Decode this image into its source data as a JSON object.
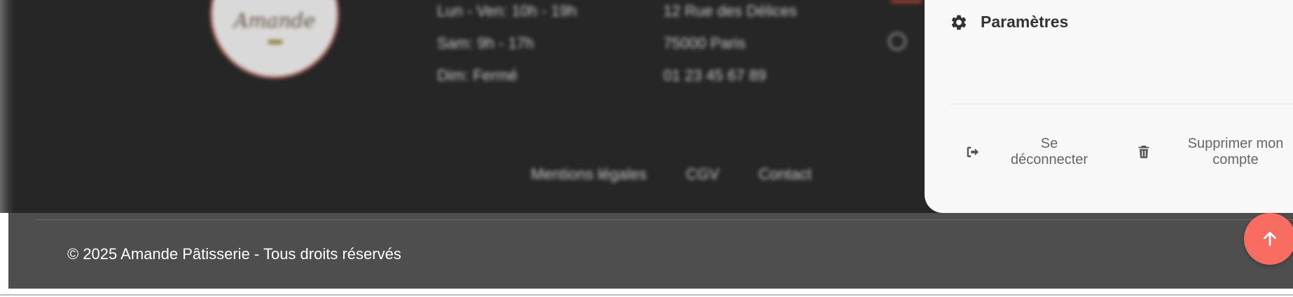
{
  "background_footer": {
    "hours": [
      "Lun - Ven: 10h - 19h",
      "Sam: 9h - 17h",
      "Dim: Fermé"
    ],
    "address": [
      "12 Rue des Délices",
      "75000 Paris",
      "01 23 45 67 89"
    ],
    "links": [
      "Mentions légales",
      "CGV",
      "Contact"
    ],
    "logo_text": "Amande"
  },
  "account_menu": {
    "settings_label": "Paramètres",
    "logout_label": "Se déconnecter",
    "delete_label": "Supprimer mon compte",
    "icons": {
      "settings": "gear-icon",
      "logout": "sign-out-icon",
      "delete": "trash-icon"
    }
  },
  "copyright": {
    "text": "© 2025 Amande Pâtisserie - Tous droits réservés"
  },
  "scroll_top": {
    "icon": "arrow-up-icon"
  },
  "colors": {
    "accent": "#f96c61",
    "footer_dark": "#262626",
    "footer_strip": "#4e4e4e",
    "panel_bg": "#f8f8f8"
  }
}
